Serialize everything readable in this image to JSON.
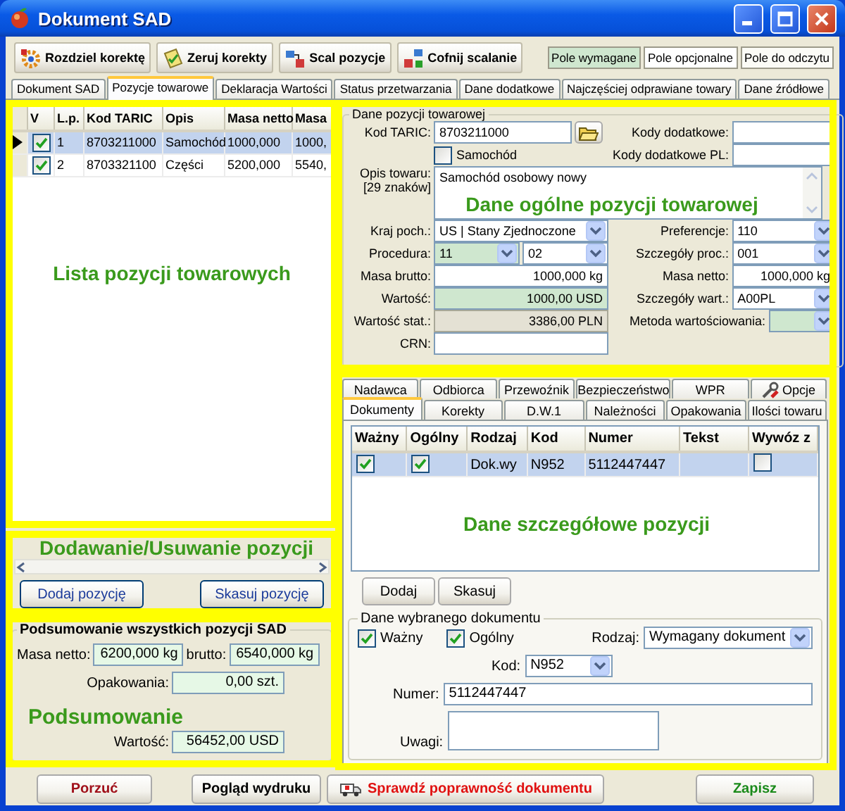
{
  "window": {
    "title": "Dokument SAD"
  },
  "toolbar": [
    {
      "label": "Rozdziel korektę"
    },
    {
      "label": "Zeruj korekty"
    },
    {
      "label": "Scal pozycje"
    },
    {
      "label": "Cofnij scalanie"
    }
  ],
  "legend": [
    {
      "label": "Pole wymagane",
      "kind": "required"
    },
    {
      "label": "Pole opcjonalne",
      "kind": "optional"
    },
    {
      "label": "Pole do odczytu",
      "kind": "readonly"
    }
  ],
  "tabs": [
    {
      "label": "Dokument SAD",
      "selected": false
    },
    {
      "label": "Pozycje towarowe",
      "selected": true
    },
    {
      "label": "Deklaracja Wartości",
      "selected": false
    },
    {
      "label": "Status przetwarzania",
      "selected": false
    },
    {
      "label": "Dane dodatkowe",
      "selected": false
    },
    {
      "label": "Najczęściej odprawiane towary",
      "selected": false
    },
    {
      "label": "Dane źródłowe",
      "selected": false
    }
  ],
  "items_table": {
    "annotation": "Lista pozycji towarowych",
    "columns": [
      "V",
      "L.p.",
      "Kod TARIC",
      "Opis",
      "Masa netto",
      "Masa"
    ],
    "rows": [
      {
        "current": true,
        "selected": true,
        "cells": [
          {
            "kind": "check",
            "checked": true
          },
          {
            "kind": "text",
            "value": "1"
          },
          {
            "kind": "text",
            "value": "8703211000"
          },
          {
            "kind": "text",
            "value": "Samochód"
          },
          {
            "kind": "text",
            "value": "1000,000"
          },
          {
            "kind": "text",
            "value": "1000,"
          }
        ]
      },
      {
        "current": false,
        "selected": false,
        "cells": [
          {
            "kind": "check",
            "checked": true
          },
          {
            "kind": "text",
            "value": "2"
          },
          {
            "kind": "text",
            "value": "8703321100"
          },
          {
            "kind": "text",
            "value": "Części"
          },
          {
            "kind": "text",
            "value": "5200,000"
          },
          {
            "kind": "text",
            "value": "5540,"
          }
        ]
      }
    ]
  },
  "item_actions": {
    "annotation": "Dodawanie/Usuwanie pozycji",
    "buttons": [
      "Dodaj pozycję",
      "Skasuj pozycję"
    ]
  },
  "summary": {
    "title": "Podsumowanie wszystkich pozycji SAD",
    "annotation": "Podsumowanie",
    "rows": [
      [
        {
          "label": "Masa netto:",
          "value": "6200,000 kg"
        },
        {
          "label": "brutto:",
          "value": "6540,000 kg"
        }
      ],
      [
        {
          "label": "Opakowania:",
          "value": "0,00 szt."
        }
      ],
      [
        {
          "label": "Wartość:",
          "value": "56452,00 USD"
        }
      ]
    ]
  },
  "item_details": {
    "title": "Dane pozycji towarowej",
    "annotation": "Dane ogólne pozycji towarowej",
    "rows": [
      {
        "left": {
          "label": "Kod TARIC:",
          "inputs": [
            {
              "kind": "text",
              "value": "8703211000",
              "required": false,
              "readonly": false
            },
            {
              "kind": "browse"
            }
          ]
        },
        "right": {
          "label": "Kody dodatkowe:",
          "inputs": [
            {
              "kind": "text",
              "required": false,
              "readonly": false
            }
          ]
        }
      },
      {
        "left": {
          "inputs": [
            {
              "kind": "checkbox",
              "label": "Samochód",
              "checked": false
            }
          ]
        },
        "right": {
          "label": "Kody dodatkowe PL:",
          "inputs": [
            {
              "kind": "text",
              "required": false,
              "readonly": false
            }
          ]
        }
      },
      {
        "full": {
          "label": "Opis towaru:",
          "note": "[29 znaków]",
          "inputs": [
            {
              "kind": "textarea",
              "value": "Samochód osobowy nowy",
              "required": false,
              "readonly": false
            }
          ]
        }
      },
      {
        "left": {
          "label": "Kraj poch.:",
          "inputs": [
            {
              "kind": "select",
              "value": "US | Stany Zjednoczone",
              "required": false,
              "readonly": false
            }
          ]
        },
        "right": {
          "label": "Preferencje:",
          "inputs": [
            {
              "kind": "select",
              "value": "110",
              "required": false,
              "readonly": false
            }
          ]
        }
      },
      {
        "left": {
          "label": "Procedura:",
          "inputs": [
            {
              "kind": "select",
              "value": "11",
              "required": true,
              "readonly": false
            },
            {
              "kind": "select",
              "value": "02",
              "required": false,
              "readonly": false
            }
          ]
        },
        "right": {
          "label": "Szczegóły proc.:",
          "inputs": [
            {
              "kind": "select",
              "value": "001",
              "required": false,
              "readonly": false
            }
          ]
        }
      },
      {
        "left": {
          "label": "Masa brutto:",
          "inputs": [
            {
              "kind": "number",
              "value": "1000,000 kg",
              "required": false,
              "readonly": false
            }
          ]
        },
        "right": {
          "label": "Masa netto:",
          "inputs": [
            {
              "kind": "number",
              "value": "1000,000 kg",
              "required": false,
              "readonly": false
            }
          ]
        }
      },
      {
        "left": {
          "label": "Wartość:",
          "inputs": [
            {
              "kind": "number",
              "value": "1000,00 USD",
              "required": true,
              "readonly": false
            }
          ]
        },
        "right": {
          "label": "Szczegóły wart.:",
          "inputs": [
            {
              "kind": "select",
              "value": "A00PL",
              "required": false,
              "readonly": false
            }
          ]
        }
      },
      {
        "left": {
          "label": "Wartość stat.:",
          "inputs": [
            {
              "kind": "number",
              "value": "3386,00 PLN",
              "required": false,
              "readonly": true
            }
          ]
        },
        "right": {
          "label": "Metoda wartościowania:",
          "inputs": [
            {
              "kind": "select",
              "required": true,
              "readonly": false
            }
          ]
        }
      },
      {
        "left": {
          "label": "CRN:",
          "inputs": [
            {
              "kind": "text",
              "required": false,
              "readonly": false
            }
          ]
        }
      }
    ]
  },
  "position_details": {
    "annotation": "Dane szczegółowe pozycji",
    "tab_rows": [
      [
        {
          "label": "Nadawca",
          "selected": false,
          "kind": "plain"
        },
        {
          "label": "Odbiorca",
          "selected": false,
          "kind": "plain"
        },
        {
          "label": "Przewoźnik",
          "selected": false,
          "kind": "plain"
        },
        {
          "label": "Bezpieczeństwo",
          "selected": false,
          "kind": "plain"
        },
        {
          "label": "WPR",
          "selected": false,
          "kind": "plain"
        },
        {
          "label": "Opcje",
          "selected": false,
          "kind": "icon"
        }
      ],
      [
        {
          "label": "Dokumenty",
          "selected": true,
          "kind": "plain"
        },
        {
          "label": "Korekty",
          "selected": false,
          "kind": "plain"
        },
        {
          "label": "D.W.1",
          "selected": false,
          "kind": "plain"
        },
        {
          "label": "Należności",
          "selected": false,
          "kind": "plain"
        },
        {
          "label": "Opakowania",
          "selected": false,
          "kind": "plain"
        },
        {
          "label": "Ilości towaru",
          "selected": false,
          "kind": "plain"
        }
      ]
    ],
    "table": {
      "columns": [
        "Ważny",
        "Ogólny",
        "Rodzaj",
        "Kod",
        "Numer",
        "Tekst",
        "Wywóz z"
      ],
      "rows": [
        {
          "selected": true,
          "cells": [
            {
              "kind": "check",
              "checked": true
            },
            {
              "kind": "check",
              "checked": true
            },
            {
              "kind": "text",
              "value": "Dok.wy"
            },
            {
              "kind": "text",
              "value": "N952"
            },
            {
              "kind": "text",
              "value": "5112447447"
            },
            {
              "kind": "text"
            },
            {
              "kind": "check",
              "checked": false
            }
          ]
        }
      ]
    },
    "buttons": [
      "Dodaj",
      "Skasuj"
    ],
    "document": {
      "title": "Dane wybranego dokumentu",
      "checks": [
        {
          "label": "Ważny",
          "checked": true
        },
        {
          "label": "Ogólny",
          "checked": true
        }
      ],
      "type": {
        "label": "Rodzaj:",
        "value": "Wymagany dokument"
      },
      "code": {
        "label": "Kod:",
        "value": "N952"
      },
      "number": {
        "label": "Numer:",
        "value": "5112447447"
      },
      "notes": {
        "label": "Uwagi:"
      }
    }
  },
  "footer": [
    {
      "label": "Porzuć",
      "kind": "cancel"
    },
    {
      "label": "Pogląd wydruku",
      "kind": "normal"
    },
    {
      "label": "Sprawdź poprawność dokumentu",
      "kind": "warning"
    },
    {
      "label": "Zapisz",
      "kind": "save"
    }
  ]
}
